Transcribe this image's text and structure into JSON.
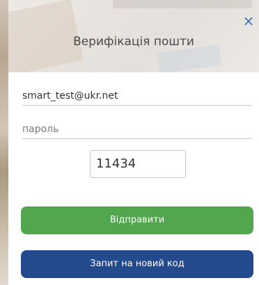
{
  "modal": {
    "title": "Верифікація пошти",
    "close_symbol": "×"
  },
  "form": {
    "email_value": "smart_test@ukr.net",
    "password_placeholder": "пароль",
    "code_value": "11434"
  },
  "buttons": {
    "send_label": "Відправити",
    "request_code_label": "Запит на новий код"
  },
  "colors": {
    "send_button": "#52a64d",
    "request_button": "#234a8c",
    "close_icon": "#3b6fb5"
  },
  "icons": {
    "close": "close-icon"
  }
}
